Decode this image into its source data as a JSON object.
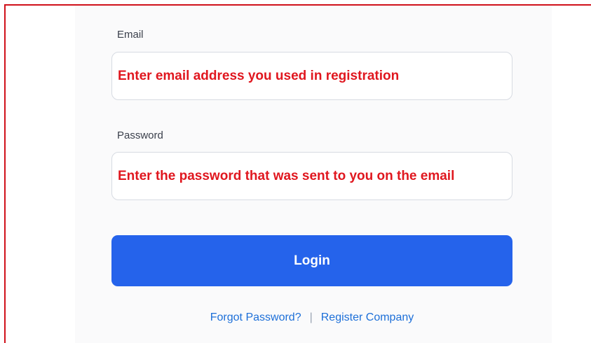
{
  "form": {
    "email_label": "Email",
    "email_placeholder": "Enter email address you used in registration",
    "password_label": "Password",
    "password_placeholder": "Enter the password that was sent to you on the email",
    "login_label": "Login",
    "forgot_link": "Forgot Password?",
    "separator": "|",
    "register_link": "Register Company"
  },
  "colors": {
    "annotation_red": "#e0171f",
    "frame_red": "#d0111b",
    "primary_blue": "#2563eb",
    "link_blue": "#1d6fd8"
  }
}
